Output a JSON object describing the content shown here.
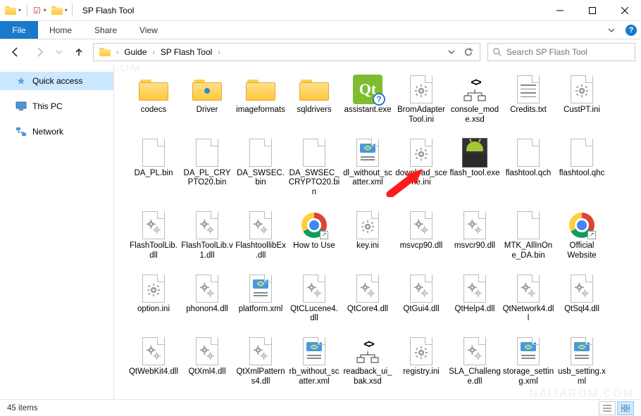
{
  "window": {
    "title": "SP Flash Tool"
  },
  "ribbon": {
    "file": "File",
    "tabs": [
      "Home",
      "Share",
      "View"
    ]
  },
  "breadcrumb": {
    "items": [
      "Guide",
      "SP Flash Tool"
    ]
  },
  "search": {
    "placeholder": "Search SP Flash Tool"
  },
  "nav": {
    "items": [
      {
        "label": "Quick access",
        "kind": "star"
      },
      {
        "label": "This PC",
        "kind": "pc"
      },
      {
        "label": "Network",
        "kind": "net"
      }
    ]
  },
  "files": [
    {
      "label": "codecs",
      "icon": "folder"
    },
    {
      "label": "Driver",
      "icon": "folder-dot"
    },
    {
      "label": "imageformats",
      "icon": "folder"
    },
    {
      "label": "sqldrivers",
      "icon": "folder"
    },
    {
      "label": "assistant.exe",
      "icon": "qt"
    },
    {
      "label": "BromAdapterTool.ini",
      "icon": "gear1"
    },
    {
      "label": "console_mode.xsd",
      "icon": "xsd"
    },
    {
      "label": "Credits.txt",
      "icon": "txt"
    },
    {
      "label": "CustPT.ini",
      "icon": "gear1"
    },
    {
      "label": "DA_PL.bin",
      "icon": "blank"
    },
    {
      "label": "DA_PL_CRYPTO20.bin",
      "icon": "blank"
    },
    {
      "label": "DA_SWSEC.bin",
      "icon": "blank"
    },
    {
      "label": "DA_SWSEC_CRYPTO20.bin",
      "icon": "blank"
    },
    {
      "label": "dl_without_scatter.xml",
      "icon": "xml"
    },
    {
      "label": "download_scene.ini",
      "icon": "gear1"
    },
    {
      "label": "flash_tool.exe",
      "icon": "android"
    },
    {
      "label": "flashtool.qch",
      "icon": "blank"
    },
    {
      "label": "flashtool.qhc",
      "icon": "blank"
    },
    {
      "label": "FlashToolLib.dll",
      "icon": "gears"
    },
    {
      "label": "FlashToolLib.v1.dll",
      "icon": "gears"
    },
    {
      "label": "FlashtoollibEx.dll",
      "icon": "gears"
    },
    {
      "label": "How to Use",
      "icon": "chrome"
    },
    {
      "label": "key.ini",
      "icon": "gear1"
    },
    {
      "label": "msvcp90.dll",
      "icon": "gears"
    },
    {
      "label": "msvcr90.dll",
      "icon": "gears"
    },
    {
      "label": "MTK_AllInOne_DA.bin",
      "icon": "blank"
    },
    {
      "label": "Official Website",
      "icon": "chrome"
    },
    {
      "label": "option.ini",
      "icon": "gear1"
    },
    {
      "label": "phonon4.dll",
      "icon": "gears"
    },
    {
      "label": "platform.xml",
      "icon": "xml"
    },
    {
      "label": "QtCLucene4.dll",
      "icon": "gears"
    },
    {
      "label": "QtCore4.dll",
      "icon": "gears"
    },
    {
      "label": "QtGui4.dll",
      "icon": "gears"
    },
    {
      "label": "QtHelp4.dll",
      "icon": "gears"
    },
    {
      "label": "QtNetwork4.dll",
      "icon": "gears"
    },
    {
      "label": "QtSql4.dll",
      "icon": "gears"
    },
    {
      "label": "QtWebKit4.dll",
      "icon": "gears"
    },
    {
      "label": "QtXml4.dll",
      "icon": "gears"
    },
    {
      "label": "QtXmlPatterns4.dll",
      "icon": "gears"
    },
    {
      "label": "rb_without_scatter.xml",
      "icon": "xml"
    },
    {
      "label": "readback_ui_bak.xsd",
      "icon": "xsd"
    },
    {
      "label": "registry.ini",
      "icon": "gear1"
    },
    {
      "label": "SLA_Challenge.dll",
      "icon": "gears"
    },
    {
      "label": "storage_setting.xml",
      "icon": "xml"
    },
    {
      "label": "usb_setting.xml",
      "icon": "xml"
    }
  ],
  "status": {
    "count": "45 items"
  },
  "watermark": "NAIJAROM.COM"
}
